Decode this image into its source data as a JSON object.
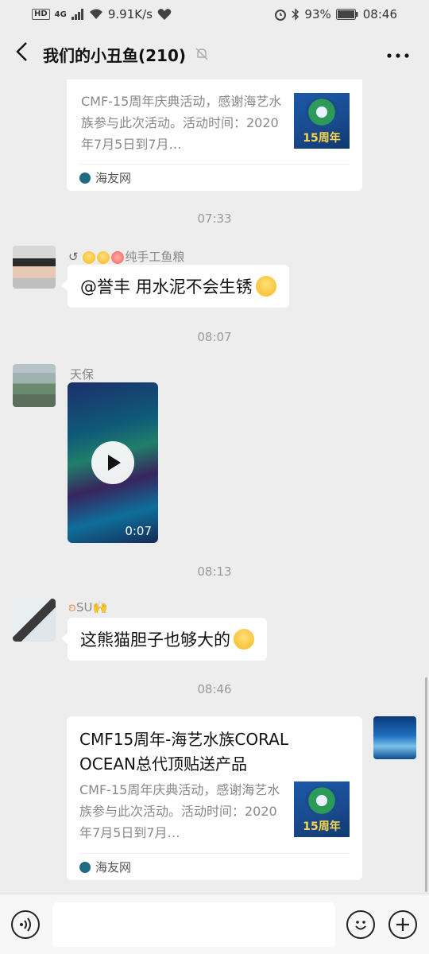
{
  "status_bar": {
    "left_badge": "HD",
    "network": "4G",
    "speed": "9.91K/s",
    "battery": "93%",
    "time": "08:46"
  },
  "header": {
    "title": "我们的小丑鱼(210)"
  },
  "messages": {
    "card_top": {
      "desc": "CMF-15周年庆典活动，感谢海艺水族参与此次活动。活动时间：2020年7月5日到7月…",
      "thumb_text": "15周年",
      "source": "海友网"
    },
    "ts1": "07:33",
    "msg1": {
      "sender": "纯手工鱼粮",
      "text": "@誉丰  用水泥不会生锈"
    },
    "ts2": "08:07",
    "msg2": {
      "sender": "天保",
      "duration": "0:07"
    },
    "ts3": "08:13",
    "msg3": {
      "sender": "SU",
      "text": "这熊猫胆子也够大的"
    },
    "ts4": "08:46",
    "card_bottom": {
      "title": "CMF15周年-海艺水族CORAL OCEAN总代顶贴送产品",
      "desc": "CMF-15周年庆典活动，感谢海艺水族参与此次活动。活动时间：2020年7月5日到7月…",
      "thumb_text": "15周年",
      "source": "海友网"
    }
  },
  "icons": {
    "back": "back-arrow",
    "mute": "bell-off",
    "more": "more-dots",
    "voice": "voice-icon",
    "emoji": "emoji-icon",
    "plus": "plus-icon"
  }
}
